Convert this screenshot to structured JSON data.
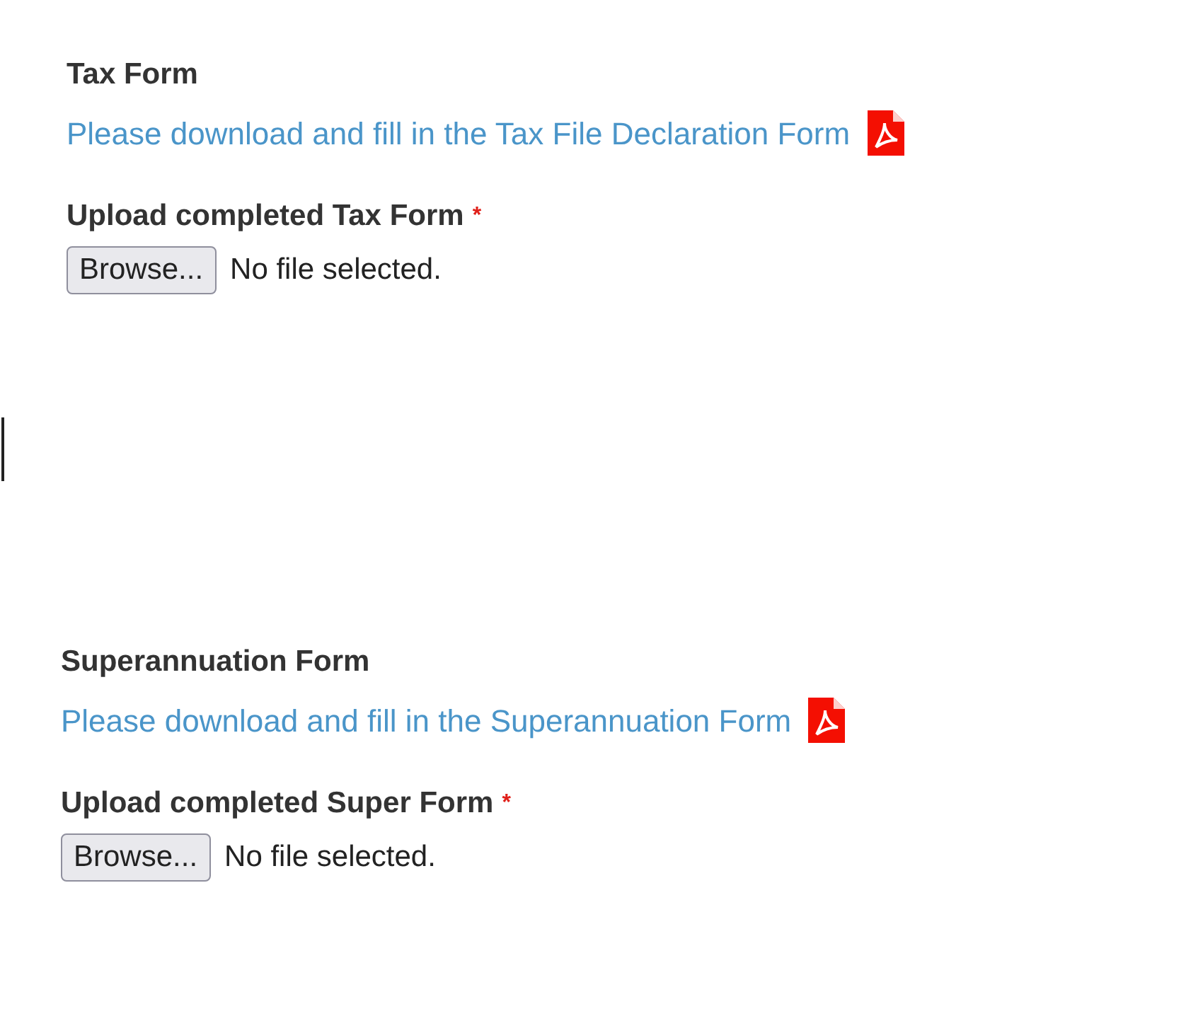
{
  "sections": [
    {
      "heading": "Tax Form",
      "link": "Please download and fill in the Tax File Declaration Form",
      "upload_label": "Upload completed Tax Form",
      "required_mark": "*",
      "button": "Browse...",
      "file_status": "No file selected."
    },
    {
      "heading": "Superannuation Form",
      "link": "Please download and fill in the Superannuation Form",
      "upload_label": "Upload completed Super Form",
      "required_mark": "*",
      "button": "Browse...",
      "file_status": "No file selected."
    }
  ]
}
